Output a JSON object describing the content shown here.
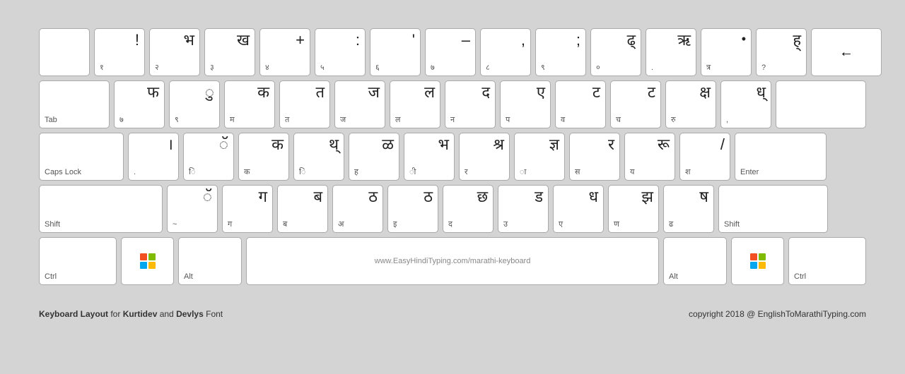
{
  "keyboard": {
    "title": "Keyboard Layout for Kurtidev and Devlys Font",
    "copyright": "copyright 2018 @ EnglishToMarathiTyping.com",
    "website": "www.EasyHindiTyping.com/marathi-keyboard",
    "rows": [
      [
        {
          "latin": "",
          "devanagari": "",
          "id": "backtick"
        },
        {
          "latin": "!",
          "devanagari": "१",
          "id": "1"
        },
        {
          "latin": "भ",
          "devanagari": "२",
          "id": "2"
        },
        {
          "latin": "ख",
          "devanagari": "३",
          "id": "3"
        },
        {
          "latin": "+",
          "devanagari": "४",
          "id": "4"
        },
        {
          "latin": ":",
          "devanagari": "५",
          "id": "5"
        },
        {
          "latin": "'",
          "devanagari": "६",
          "id": "6"
        },
        {
          "latin": "–",
          "devanagari": "७",
          "id": "7"
        },
        {
          "latin": ",",
          "devanagari": "८",
          "id": "8"
        },
        {
          "latin": ";",
          "devanagari": "९",
          "id": "9"
        },
        {
          "latin": "ढ्",
          "devanagari": "०",
          "id": "0"
        },
        {
          "latin": "ऋ",
          "devanagari": ".",
          "id": "minus"
        },
        {
          "latin": "•",
          "devanagari": "त्र",
          "id": "equals"
        },
        {
          "latin": "ह्",
          "devanagari": "?",
          "id": "bracket"
        },
        {
          "latin": "←",
          "devanagari": "",
          "id": "backspace",
          "special": "backspace"
        }
      ],
      [
        {
          "latin": "Tab",
          "devanagari": "",
          "id": "tab",
          "special": "tab"
        },
        {
          "latin": "फ",
          "devanagari": "७",
          "id": "q"
        },
        {
          "latin": "ु",
          "devanagari": "९",
          "id": "w"
        },
        {
          "latin": "क",
          "devanagari": "म",
          "id": "e"
        },
        {
          "latin": "त",
          "devanagari": "त",
          "id": "r"
        },
        {
          "latin": "ज",
          "devanagari": "ज",
          "id": "t"
        },
        {
          "latin": "ल",
          "devanagari": "ल",
          "id": "y"
        },
        {
          "latin": "द",
          "devanagari": "न",
          "id": "u"
        },
        {
          "latin": "ए",
          "devanagari": "प",
          "id": "i"
        },
        {
          "latin": "ट",
          "devanagari": "व",
          "id": "o"
        },
        {
          "latin": "ट",
          "devanagari": "च",
          "id": "p"
        },
        {
          "latin": "क्ष",
          "devanagari": "रु",
          "id": "lbracket"
        },
        {
          "latin": "ध्",
          "devanagari": ",",
          "id": "rbracket"
        },
        {
          "latin": "",
          "devanagari": "",
          "id": "backslash"
        }
      ],
      [
        {
          "latin": "Caps Lock",
          "devanagari": "",
          "id": "caps",
          "special": "caps"
        },
        {
          "latin": "।",
          "devanagari": ".",
          "id": "a"
        },
        {
          "latin": "ॅ",
          "devanagari": "ि",
          "id": "s"
        },
        {
          "latin": "क",
          "devanagari": "क",
          "id": "d"
        },
        {
          "latin": "थ्",
          "devanagari": "ि",
          "id": "f"
        },
        {
          "latin": "ळ",
          "devanagari": "ह",
          "id": "g"
        },
        {
          "latin": "भ",
          "devanagari": "ी",
          "id": "h"
        },
        {
          "latin": "श्र",
          "devanagari": "र",
          "id": "j"
        },
        {
          "latin": "ज्ञ",
          "devanagari": "ा",
          "id": "k"
        },
        {
          "latin": "र",
          "devanagari": "स",
          "id": "l"
        },
        {
          "latin": "रू",
          "devanagari": "य",
          "id": "semicolon"
        },
        {
          "latin": "/",
          "devanagari": "श",
          "id": "quote"
        },
        {
          "latin": "Enter",
          "devanagari": "",
          "id": "enter",
          "special": "enter"
        }
      ],
      [
        {
          "latin": "Shift",
          "devanagari": "",
          "id": "shift-left",
          "special": "shift-left"
        },
        {
          "latin": "ॅ",
          "devanagari": "~",
          "id": "z"
        },
        {
          "latin": "ग",
          "devanagari": "ग",
          "id": "x"
        },
        {
          "latin": "ब",
          "devanagari": "ब",
          "id": "c"
        },
        {
          "latin": "ठ",
          "devanagari": "अ",
          "id": "v"
        },
        {
          "latin": "ठ",
          "devanagari": "इ",
          "id": "b"
        },
        {
          "latin": "छ",
          "devanagari": "द",
          "id": "n"
        },
        {
          "latin": "ड",
          "devanagari": "उ",
          "id": "m"
        },
        {
          "latin": "ध",
          "devanagari": "ए",
          "id": "comma"
        },
        {
          "latin": "झ",
          "devanagari": "ण",
          "id": "period"
        },
        {
          "latin": "ष",
          "devanagari": "ढ",
          "id": "slash"
        },
        {
          "latin": "Shift",
          "devanagari": "",
          "id": "shift-right",
          "special": "shift-right"
        }
      ],
      [
        {
          "latin": "Ctrl",
          "devanagari": "",
          "id": "ctrl-left",
          "special": "ctrl"
        },
        {
          "latin": "Win",
          "devanagari": "",
          "id": "win-left",
          "special": "win"
        },
        {
          "latin": "Alt",
          "devanagari": "",
          "id": "alt-left",
          "special": "alt"
        },
        {
          "latin": "www.EasyHindiTyping.com/marathi-keyboard",
          "devanagari": "",
          "id": "space",
          "special": "space"
        },
        {
          "latin": "Alt",
          "devanagari": "",
          "id": "alt-right",
          "special": "alt-right"
        },
        {
          "latin": "Win",
          "devanagari": "",
          "id": "win-right",
          "special": "win"
        },
        {
          "latin": "Ctrl",
          "devanagari": "",
          "id": "ctrl-right",
          "special": "ctrl-right"
        }
      ]
    ]
  }
}
